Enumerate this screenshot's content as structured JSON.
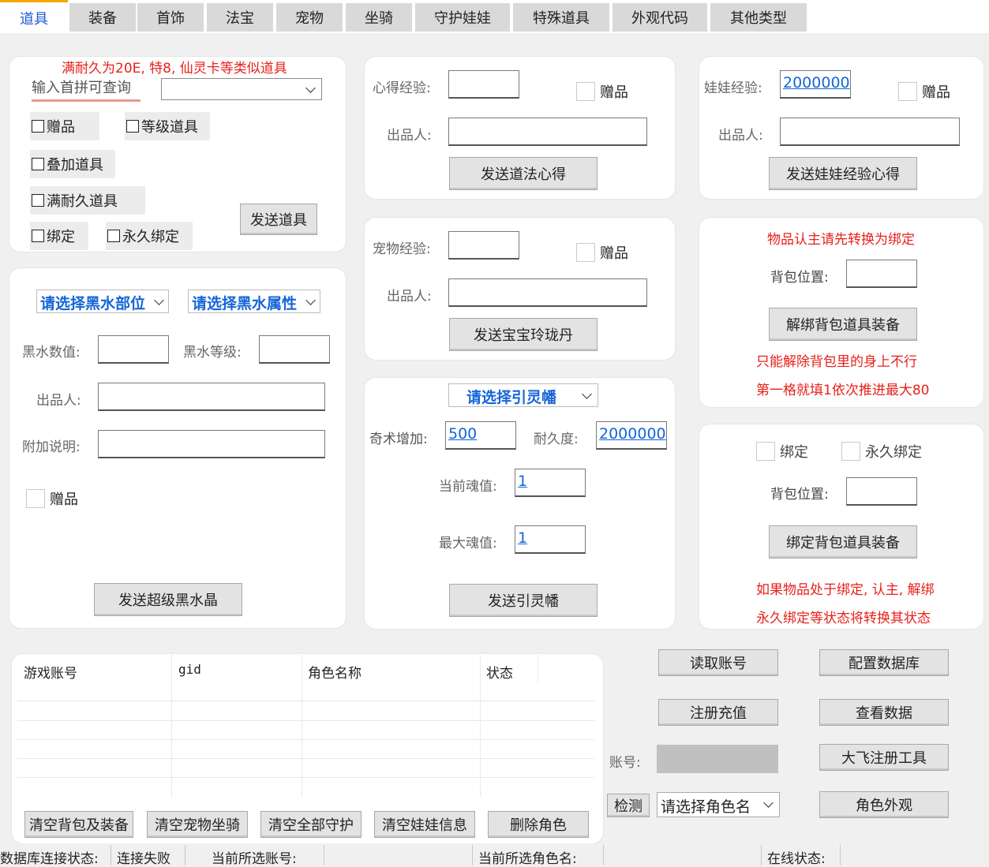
{
  "tabs": [
    {
      "label": "道具"
    },
    {
      "label": "装备"
    },
    {
      "label": "首饰"
    },
    {
      "label": "法宝"
    },
    {
      "label": "宠物"
    },
    {
      "label": "坐骑"
    },
    {
      "label": "守护娃娃"
    },
    {
      "label": "特殊道具"
    },
    {
      "label": "外观代码"
    },
    {
      "label": "其他类型"
    }
  ],
  "item_panel": {
    "note": "满耐久为20E, 特8, 仙灵卡等类似道具",
    "search_label": "输入首拼可查询",
    "search_value": "",
    "gift_label": "赠品",
    "level_item_label": "等级道具",
    "stack_item_label": "叠加道具",
    "full_durability_label": "满耐久道具",
    "bind_label": "绑定",
    "perm_bind_label": "永久绑定",
    "send_button": "发送道具"
  },
  "black_water_panel": {
    "part_select": "请选择黑水部位",
    "attr_select": "请选择黑水属性",
    "value_label": "黑水数值:",
    "value": "",
    "level_label": "黑水等级:",
    "level": "",
    "producer_label": "出品人:",
    "producer": "",
    "extra_label": "附加说明:",
    "extra": "",
    "gift_label": "赠品",
    "send_button": "发送超级黑水晶"
  },
  "xinde_panel": {
    "exp_label": "心得经验:",
    "exp_value": "",
    "gift_label": "赠品",
    "producer_label": "出品人:",
    "producer": "",
    "send_button": "发送道法心得"
  },
  "pet_exp_panel": {
    "exp_label": "宠物经验:",
    "exp_value": "",
    "gift_label": "赠品",
    "producer_label": "出品人:",
    "producer": "",
    "send_button": "发送宝宝玲珑丹"
  },
  "banner_panel": {
    "select": "请选择引灵幡",
    "qishu_label": "奇术增加:",
    "qishu_value": "500",
    "durability_label": "耐久度:",
    "durability_value": "2000000",
    "cur_soul_label": "当前魂值:",
    "cur_soul_value": "1",
    "max_soul_label": "最大魂值:",
    "max_soul_value": "1",
    "send_button": "发送引灵幡"
  },
  "doll_panel": {
    "exp_label": "娃娃经验:",
    "exp_value": "2000000",
    "gift_label": "赠品",
    "producer_label": "出品人:",
    "producer": "",
    "send_button": "发送娃娃经验心得"
  },
  "unbind_panel": {
    "note_top": "物品认主请先转换为绑定",
    "slot_label": "背包位置:",
    "slot_value": "",
    "button": "解绑背包道具装备",
    "note_line1": "只能解除背包里的身上不行",
    "note_line2": "第一格就填1依次推进最大80"
  },
  "bind_panel": {
    "bind_label": "绑定",
    "perm_bind_label": "永久绑定",
    "slot_label": "背包位置:",
    "slot_value": "",
    "button": "绑定背包道具装备",
    "note_line1": "如果物品处于绑定, 认主, 解绑",
    "note_line2": "永久绑定等状态将转换其状态"
  },
  "account_table": {
    "columns": [
      "游戏账号",
      "gid",
      "角色名称",
      "状态"
    ],
    "rows": []
  },
  "bottom_buttons": {
    "clear_bag": "清空背包及装备",
    "clear_pet": "清空宠物坐骑",
    "clear_guard": "清空全部守护",
    "clear_doll": "清空娃娃信息",
    "delete_role": "删除角色"
  },
  "right_controls": {
    "read_account": "读取账号",
    "config_db": "配置数据库",
    "register_recharge": "注册充值",
    "view_data": "查看数据",
    "account_label": "账号:",
    "account_value": "",
    "dafei_tool": "大飞注册工具",
    "check_button": "检测",
    "role_select": "请选择角色名",
    "role_look": "角色外观"
  },
  "status_bar": {
    "db_label": "数据库连接状态:",
    "db_value": "连接失败",
    "account_label": "当前所选账号:",
    "account_value": "",
    "role_label": "当前所选角色名:",
    "role_value": "",
    "online_label": "在线状态:",
    "online_value": ""
  },
  "colors": {
    "accent_blue": "#1565d8",
    "warning_red": "#e8201a",
    "active_tab_top": "#f2a800",
    "card_bg": "#ffffff",
    "window_bg": "#f0f0f0"
  }
}
